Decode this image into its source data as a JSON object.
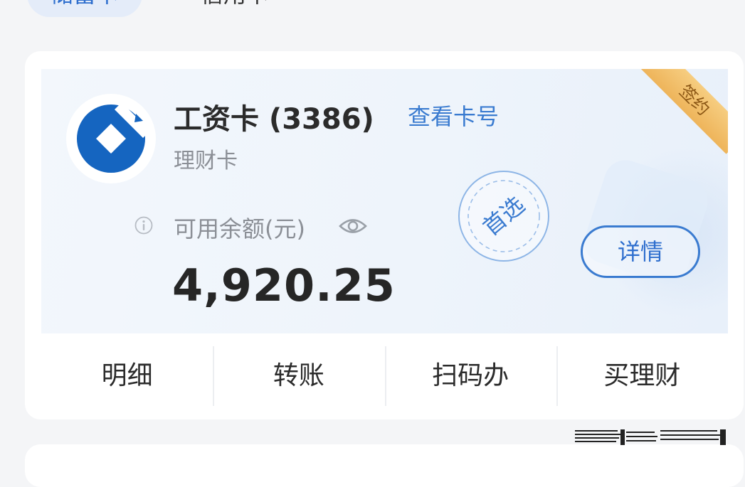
{
  "tabs": [
    {
      "label": "储蓄卡",
      "active": true
    },
    {
      "label": "信用卡",
      "active": false
    }
  ],
  "card": {
    "title": "工资卡 (3386)",
    "view_number_link": "查看卡号",
    "type": "理财卡",
    "ribbon": "签约",
    "stamp": "首选",
    "balance_label": "可用余额(元)",
    "balance": "4,920.25",
    "details_button": "详情"
  },
  "actions": [
    "明细",
    "转账",
    "扫码办",
    "买理财"
  ],
  "colors": {
    "accent": "#3a7bd0",
    "bank_blue": "#1565c0",
    "ribbon": "#f0b75c",
    "background": "#f4f5f7"
  },
  "icons": [
    "bank-logo-icon",
    "info-icon",
    "eye-icon",
    "preferred-stamp-icon"
  ]
}
